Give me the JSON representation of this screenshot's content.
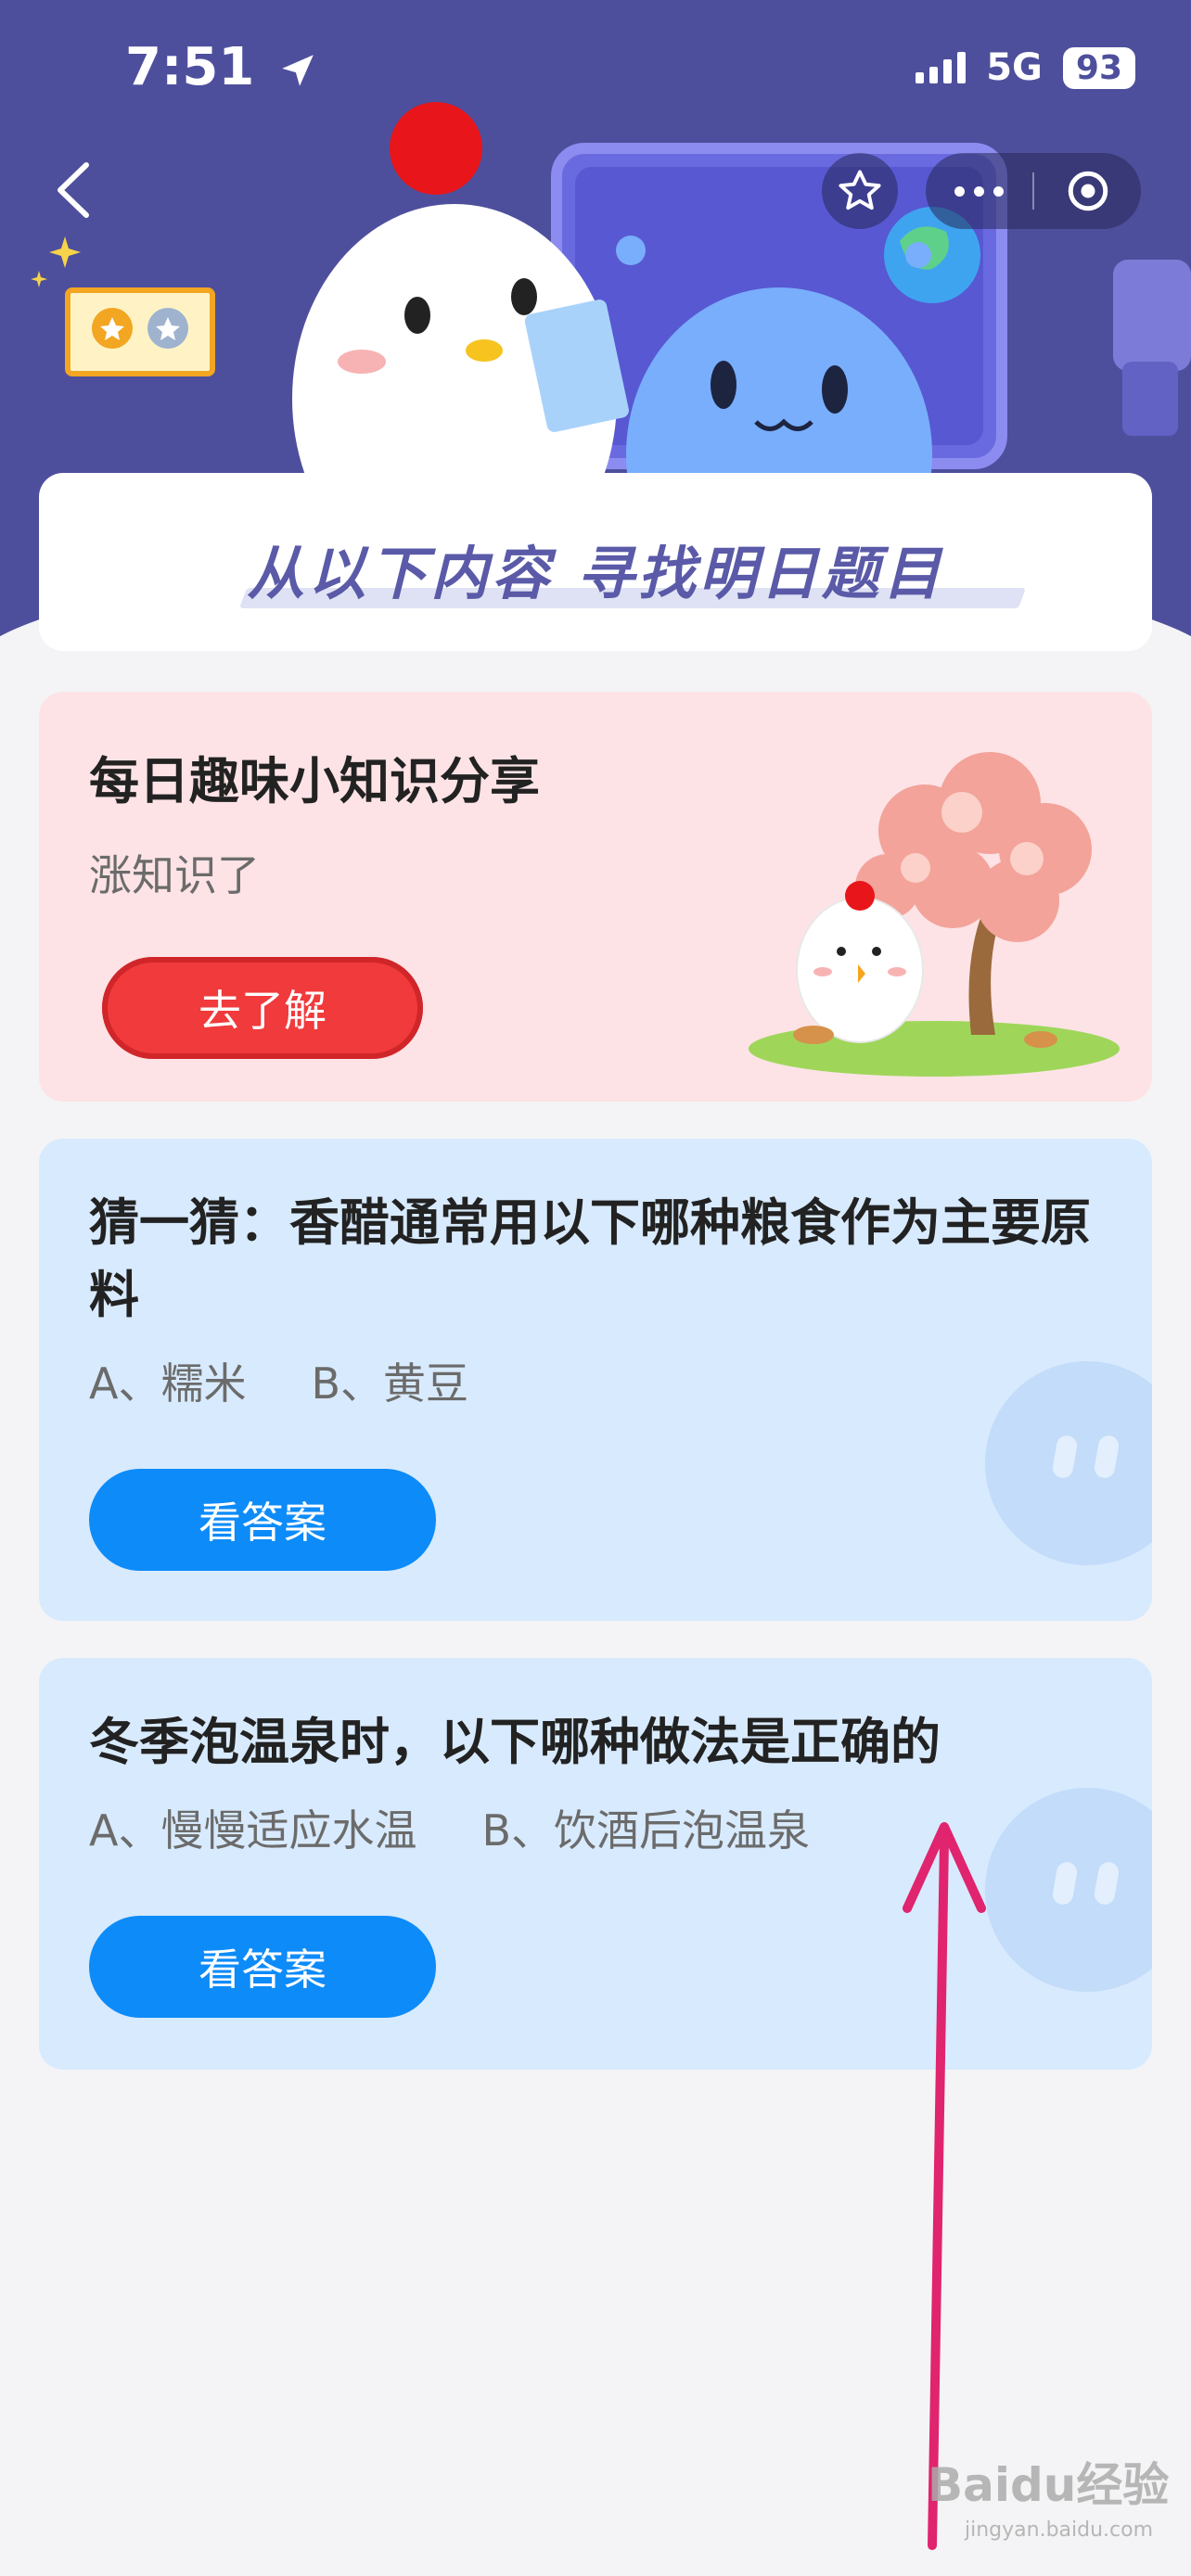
{
  "status": {
    "time": "7:51",
    "network": "5G",
    "battery": "93"
  },
  "banner": {
    "title": "从以下内容 寻找明日题目"
  },
  "cards": [
    {
      "title": "每日趣味小知识分享",
      "subtitle": "涨知识了",
      "button": "去了解"
    },
    {
      "title": "猜一猜：香醋通常用以下哪种粮食作为主要原料",
      "option_a": "A、糯米",
      "option_b": "B、黄豆",
      "button": "看答案"
    },
    {
      "title": "冬季泡温泉时，以下哪种做法是正确的",
      "option_a": "A、慢慢适应水温",
      "option_b": "B、饮酒后泡温泉",
      "button": "看答案"
    }
  ],
  "watermark": {
    "logo": "Baidu经验",
    "url": "jingyan.baidu.com"
  },
  "colors": {
    "header": "#4e4f9c",
    "pink_card": "#fde3e6",
    "blue_card": "#d8eafd",
    "red_button": "#f03a3c",
    "blue_button": "#0d8bf8",
    "arrow": "#e0246e"
  }
}
